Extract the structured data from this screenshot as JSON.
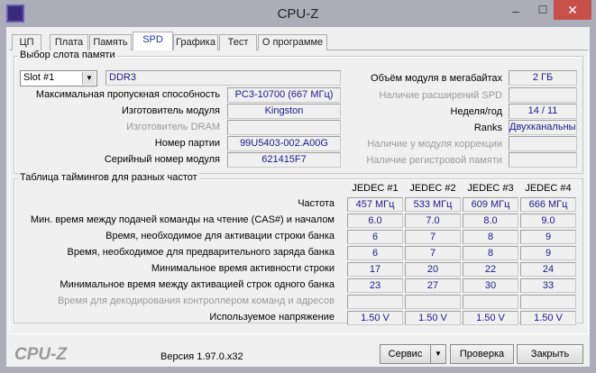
{
  "window": {
    "title": "CPU-Z",
    "minimize": "–",
    "maximize": "☐",
    "close": "✕"
  },
  "tabs": [
    {
      "label": "ЦП"
    },
    {
      "label": "Плата"
    },
    {
      "label": "Память"
    },
    {
      "label": "SPD",
      "active": true
    },
    {
      "label": "Графика"
    },
    {
      "label": "Тест"
    },
    {
      "label": "О программе"
    }
  ],
  "slot_group": {
    "title": "Выбор слота памяти",
    "slot_select": "Slot #1",
    "memory_type": "DDR3",
    "left_fields": [
      {
        "label": "Максимальная пропускная способность",
        "value": "PC3-10700 (667 МГц)",
        "enabled": true
      },
      {
        "label": "Изготовитель модуля",
        "value": "Kingston",
        "enabled": true
      },
      {
        "label": "Изготовитель DRAM",
        "value": "",
        "enabled": false
      },
      {
        "label": "Номер партии",
        "value": "99U5403-002.A00G",
        "enabled": true
      },
      {
        "label": "Серийный номер модуля",
        "value": "621415F7",
        "enabled": true
      }
    ],
    "right_fields": [
      {
        "label": "Объём модуля в мегабайтах",
        "value": "2 ГБ",
        "enabled": true
      },
      {
        "label": "Наличие расширений SPD",
        "value": "",
        "enabled": false
      },
      {
        "label": "Неделя/год",
        "value": "14 / 11",
        "enabled": true
      },
      {
        "label": "Ranks",
        "value": "Двухканальный",
        "enabled": true
      },
      {
        "label": "Наличие у модуля коррекции",
        "value": "",
        "enabled": false
      },
      {
        "label": "Наличие регистровой памяти",
        "value": "",
        "enabled": false
      }
    ]
  },
  "timings": {
    "title": "Таблица таймингов для разных частот",
    "columns": [
      "JEDEC #1",
      "JEDEC #2",
      "JEDEC #3",
      "JEDEC #4"
    ],
    "rows": [
      {
        "label": "Частота",
        "values": [
          "457 МГц",
          "533 МГц",
          "609 МГц",
          "666 МГц"
        ],
        "enabled": true
      },
      {
        "label": "Мин. время между подачей команды на чтение (CAS#) и началом",
        "values": [
          "6.0",
          "7.0",
          "8.0",
          "9.0"
        ],
        "enabled": true
      },
      {
        "label": "Время, необходимое для активации строки банка",
        "values": [
          "6",
          "7",
          "8",
          "9"
        ],
        "enabled": true
      },
      {
        "label": "Время, необходимое для предварительного заряда банка",
        "values": [
          "6",
          "7",
          "8",
          "9"
        ],
        "enabled": true
      },
      {
        "label": "Минимальное время активности строки",
        "values": [
          "17",
          "20",
          "22",
          "24"
        ],
        "enabled": true
      },
      {
        "label": "Минимальное время между активацией строк одного банка",
        "values": [
          "23",
          "27",
          "30",
          "33"
        ],
        "enabled": true
      },
      {
        "label": "Время для декодирования контроллером команд и адресов",
        "values": [
          "",
          "",
          "",
          ""
        ],
        "enabled": false
      },
      {
        "label": "Используемое напряжение",
        "values": [
          "1.50 V",
          "1.50 V",
          "1.50 V",
          "1.50 V"
        ],
        "enabled": true
      }
    ]
  },
  "footer": {
    "logo": "CPU-Z",
    "version": "Версия 1.97.0.x32",
    "service": "Сервис",
    "validate": "Проверка",
    "close": "Закрыть"
  }
}
